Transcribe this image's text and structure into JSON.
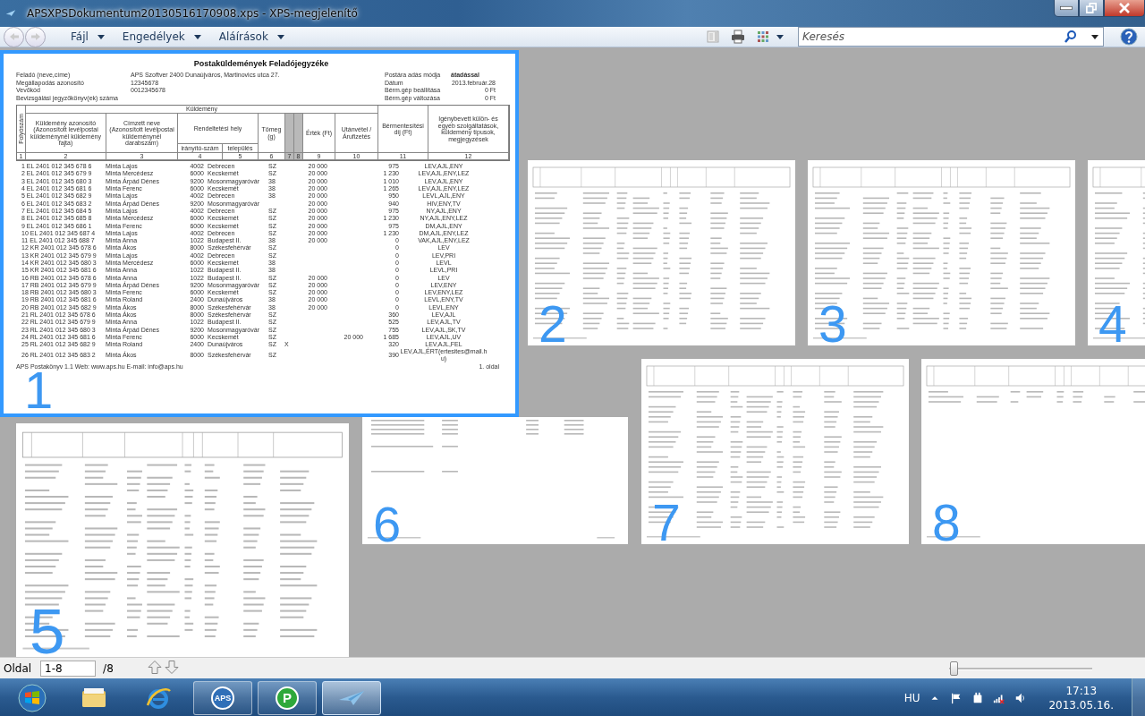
{
  "window": {
    "title": "APSXPSDokumentum20130516170908.xps - XPS-megjelenítő"
  },
  "menus": [
    {
      "label": "Fájl"
    },
    {
      "label": "Engedélyek"
    },
    {
      "label": "Aláírások"
    }
  ],
  "search": {
    "placeholder": "Keresés"
  },
  "pages": [
    {
      "number": "1",
      "selected": true,
      "document": {
        "title": "Postaküldemények Feladójegyzéke",
        "meta_left": [
          {
            "label": "Feladó (neve,címe)",
            "value": "APS Szoftver 2400 Dunaújváros, Martinovics utca 27."
          },
          {
            "label": "Megállapodás azonosító",
            "value": "12345678"
          },
          {
            "label": "Vevőkód",
            "value": "0012345678"
          },
          {
            "label": "Bevizsgálási jegyzőkönyv(ek) száma"
          }
        ],
        "meta_right": [
          {
            "label": "Postára adás módja",
            "value": "átadással"
          },
          {
            "label": "Dátum",
            "value": "2013.február.28"
          },
          {
            "label": "Bérm.gép beállítása",
            "value": "0 Ft"
          },
          {
            "label": "Bérm.gép változása",
            "value": "0 Ft"
          }
        ],
        "header": {
          "serial": "Folyószám",
          "group": "Küldemény",
          "id": "Küldemény azonosító (Azonosított levélpostai küldeménynél küldemény fajta)",
          "recipient": "Címzett neve (Azonosított levélpostai küldeménynél darabszám)",
          "destination": "Rendeltetési hely",
          "zip": "irányító-szám",
          "city": "település",
          "weight": "Tömeg (g)",
          "value": "Érték (Ft)",
          "cod": "Utánvétel / Árufizetés",
          "postage": "Bérmentesítési díj (Ft)",
          "services": "Igénybevett külön- és egyéb szolgáltatások, küldemény típusok, megjegyzések"
        },
        "column_numbers": [
          "1",
          "2",
          "3",
          "4",
          "5",
          "6",
          "7",
          "8",
          "9",
          "10",
          "11",
          "12"
        ],
        "rows": [
          [
            "1 EL 2401 012 345 678 6",
            "Minta Lajos",
            "4002",
            "Debrecen",
            "SZ",
            "",
            "20 000",
            "",
            "975",
            "LEV,AJL,ENY"
          ],
          [
            "2 EL 2401 012 345 679 9",
            "Minta Mercédesz",
            "6000",
            "Kecskemét",
            "SZ",
            "",
            "20 000",
            "",
            "1 230",
            "LEV,AJL,ENY,LEZ"
          ],
          [
            "3 EL 2401 012 345 680 3",
            "Minta Árpád Dénes",
            "9200",
            "Mosonmagyaróvár",
            "38",
            "",
            "20 000",
            "",
            "1 010",
            "LEV,AJL,ENY"
          ],
          [
            "4 EL 2401 012 345 681 6",
            "Minta Ferenc",
            "6000",
            "Kecskemét",
            "38",
            "",
            "20 000",
            "",
            "1 265",
            "LEV,AJL,ENY,LEZ"
          ],
          [
            "5 EL 2401 012 345 682 9",
            "Minta Lajos",
            "4002",
            "Debrecen",
            "38",
            "",
            "20 000",
            "",
            "950",
            "LEVL,AJL,ENY"
          ],
          [
            "6 EL 2401 012 345 683 2",
            "Minta Árpád Dénes",
            "9200",
            "Mosonmagyaróvár",
            "",
            "",
            "20 000",
            "",
            "940",
            "HIV,ENY,TV"
          ],
          [
            "7 EL 2401 012 345 684 5",
            "Minta Lajos",
            "4002",
            "Debrecen",
            "SZ",
            "",
            "20 000",
            "",
            "975",
            "NY,AJL,ENY"
          ],
          [
            "8 EL 2401 012 345 685 8",
            "Minta Mercédesz",
            "6000",
            "Kecskemét",
            "SZ",
            "",
            "20 000",
            "",
            "1 230",
            "NY,AJL,ENY,LEZ"
          ],
          [
            "9 EL 2401 012 345 686 1",
            "Minta Ferenc",
            "6000",
            "Kecskemét",
            "SZ",
            "",
            "20 000",
            "",
            "975",
            "DM,AJL,ENY"
          ],
          [
            "10 EL 2401 012 345 687 4",
            "Minta Lajos",
            "4002",
            "Debrecen",
            "SZ",
            "",
            "20 000",
            "",
            "1 230",
            "DM,AJL,ENY,LEZ"
          ],
          [
            "11 EL 2401 012 345 688 7",
            "Minta Anna",
            "1022",
            "Budapest II.",
            "38",
            "",
            "20 000",
            "",
            "0",
            "VAK,AJL,ENY,LEZ"
          ],
          [
            "12 KR 2401 012 345 678 6",
            "Minta Ákos",
            "8000",
            "Székesfehérvár",
            "SZ",
            "",
            "",
            "",
            "0",
            "LEV"
          ],
          [
            "13 KR 2401 012 345 679 9",
            "Minta Lajos",
            "4002",
            "Debrecen",
            "SZ",
            "",
            "",
            "",
            "0",
            "LEV,PRI"
          ],
          [
            "14 KR 2401 012 345 680 3",
            "Minta Mercédesz",
            "6000",
            "Kecskemét",
            "38",
            "",
            "",
            "",
            "0",
            "LEVL"
          ],
          [
            "15 KR 2401 012 345 681 6",
            "Minta Anna",
            "1022",
            "Budapest II.",
            "38",
            "",
            "",
            "",
            "0",
            "LEVL,PRI"
          ],
          [
            "16 RB 2401 012 345 678 6",
            "Minta Anna",
            "1022",
            "Budapest II.",
            "SZ",
            "",
            "20 000",
            "",
            "0",
            "LEV"
          ],
          [
            "17 RB 2401 012 345 679 9",
            "Minta Árpád Dénes",
            "9200",
            "Mosonmagyaróvár",
            "SZ",
            "",
            "20 000",
            "",
            "0",
            "LEV,ENY"
          ],
          [
            "18 RB 2401 012 345 680 3",
            "Minta Ferenc",
            "6000",
            "Kecskemét",
            "SZ",
            "",
            "20 000",
            "",
            "0",
            "LEV,ENY,LEZ"
          ],
          [
            "19 RB 2401 012 345 681 6",
            "Minta Roland",
            "2400",
            "Dunaújváros",
            "38",
            "",
            "20 000",
            "",
            "0",
            "LEVL,ENY,TV"
          ],
          [
            "20 RB 2401 012 345 682 9",
            "Minta Ákos",
            "8000",
            "Székesfehérvár",
            "38",
            "",
            "20 000",
            "",
            "0",
            "LEVL,ENY"
          ],
          [
            "21 RL 2401 012 345 678 6",
            "Minta Ákos",
            "8000",
            "Székesfehérvár",
            "SZ",
            "",
            "",
            "",
            "360",
            "LEV,AJL"
          ],
          [
            "22 RL 2401 012 345 679 9",
            "Minta Anna",
            "1022",
            "Budapest II.",
            "SZ",
            "",
            "",
            "",
            "525",
            "LEV,AJL,TV"
          ],
          [
            "23 RL 2401 012 345 680 3",
            "Minta Árpád Dénes",
            "9200",
            "Mosonmagyaróvár",
            "SZ",
            "",
            "",
            "",
            "755",
            "LEV,AJL,SK,TV"
          ],
          [
            "24 RL 2401 012 345 681 6",
            "Minta Ferenc",
            "6000",
            "Kecskemét",
            "SZ",
            "",
            "",
            "20 000",
            "1 685",
            "LEV,AJL,UV"
          ],
          [
            "25 RL 2401 012 345 682 9",
            "Minta Roland",
            "2400",
            "Dunaújváros",
            "SZ",
            "X",
            "",
            "",
            "320",
            "LEV,AJL,FEL"
          ],
          [
            "26 RL 2401 012 345 683 2",
            "Minta Ákos",
            "8000",
            "Székesfehérvár",
            "SZ",
            "",
            "",
            "",
            "390",
            "LEV,AJL,ÉRT(ertesites@mail.hu)"
          ]
        ],
        "footer": "APS Postakönyv 1.1 Web: www.aps.hu E-mail: info@aps.hu",
        "page_label": "1. oldal"
      }
    },
    {
      "number": "2",
      "selected": false
    },
    {
      "number": "3",
      "selected": false
    },
    {
      "number": "4",
      "selected": false
    },
    {
      "number": "5",
      "selected": false
    },
    {
      "number": "6",
      "selected": false
    },
    {
      "number": "7",
      "selected": false
    },
    {
      "number": "8",
      "selected": false
    }
  ],
  "status_bar": {
    "label": "Oldal",
    "page_field": "1-8",
    "total": "/8",
    "zoom": {
      "level": 0.03
    }
  },
  "taskbar": {
    "apps": [
      {
        "kind": "start",
        "selected": false
      },
      {
        "kind": "explorer",
        "selected": false
      },
      {
        "kind": "browser",
        "selected": false
      },
      {
        "kind": "aps",
        "label": "APS",
        "selected": false
      },
      {
        "kind": "p",
        "label": "P",
        "selected": false
      },
      {
        "kind": "xps",
        "selected": true
      }
    ],
    "language": "HU",
    "time": "17:13",
    "date": "2013.05.16."
  }
}
